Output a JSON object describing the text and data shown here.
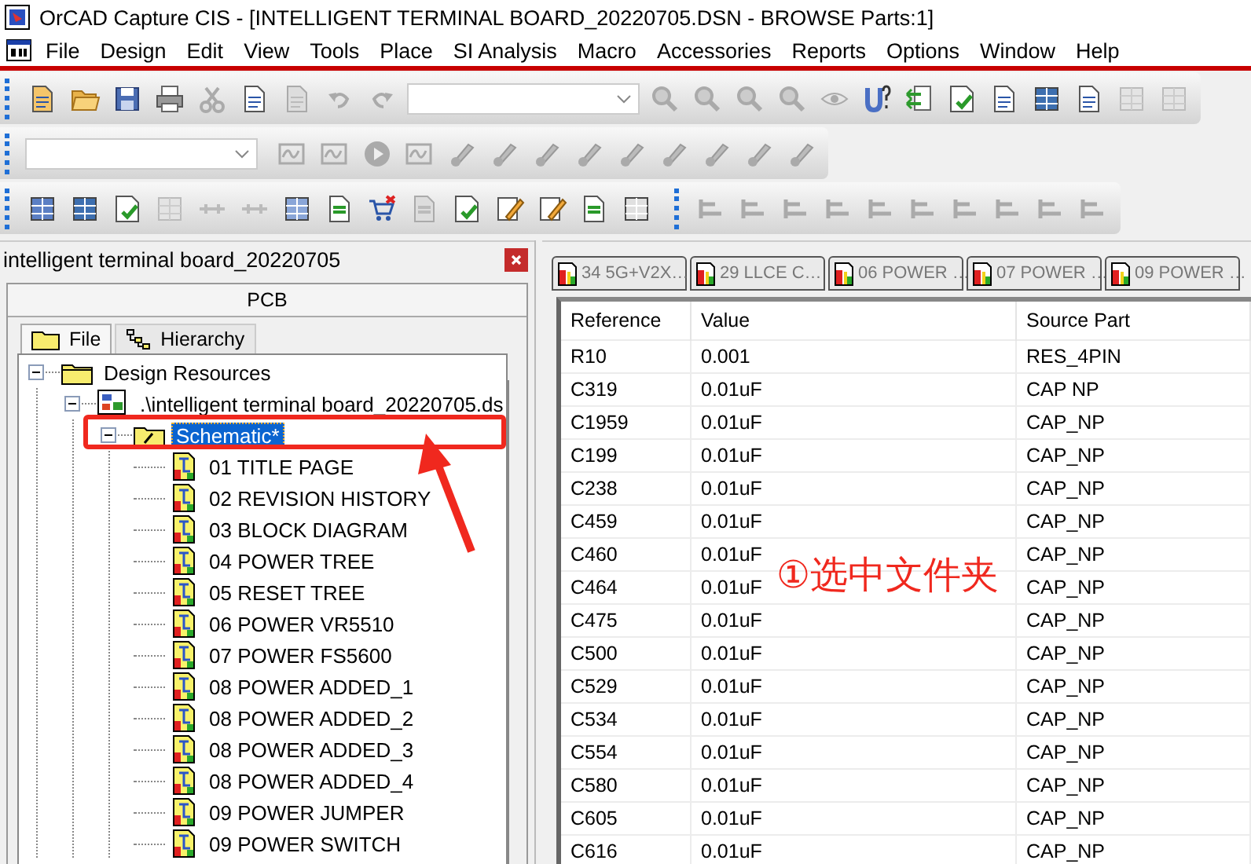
{
  "window": {
    "title": "OrCAD Capture CIS - [INTELLIGENT TERMINAL BOARD_20220705.DSN - BROWSE Parts:1]"
  },
  "menu": [
    "File",
    "Design",
    "Edit",
    "View",
    "Tools",
    "Place",
    "SI Analysis",
    "Macro",
    "Accessories",
    "Reports",
    "Options",
    "Window",
    "Help"
  ],
  "project_panel": {
    "title": "intelligent terminal board_20220705",
    "header": "PCB",
    "tabs": [
      {
        "label": "File",
        "selected": true
      },
      {
        "label": "Hierarchy",
        "selected": false
      }
    ],
    "tree": [
      {
        "label": "Design Resources",
        "kind": "folder",
        "expanded": true,
        "selected": false,
        "children": [
          {
            "label": ".\\intelligent terminal board_20220705.ds",
            "kind": "design",
            "expanded": true,
            "selected": false,
            "children": [
              {
                "label": "Schematic*",
                "kind": "schematic",
                "expanded": true,
                "selected": true,
                "children": [
                  {
                    "label": "01 TITLE PAGE",
                    "kind": "page",
                    "selected": false
                  },
                  {
                    "label": "02 REVISION HISTORY",
                    "kind": "page",
                    "selected": false
                  },
                  {
                    "label": "03 BLOCK DIAGRAM",
                    "kind": "page",
                    "selected": false
                  },
                  {
                    "label": "04 POWER TREE",
                    "kind": "page",
                    "selected": false
                  },
                  {
                    "label": "05 RESET TREE",
                    "kind": "page",
                    "selected": false
                  },
                  {
                    "label": "06 POWER VR5510",
                    "kind": "page",
                    "selected": false
                  },
                  {
                    "label": "07 POWER FS5600",
                    "kind": "page",
                    "selected": false
                  },
                  {
                    "label": "08 POWER ADDED_1",
                    "kind": "page",
                    "selected": false
                  },
                  {
                    "label": "08 POWER ADDED_2",
                    "kind": "page",
                    "selected": false
                  },
                  {
                    "label": "08 POWER ADDED_3",
                    "kind": "page",
                    "selected": false
                  },
                  {
                    "label": "08 POWER ADDED_4",
                    "kind": "page",
                    "selected": false
                  },
                  {
                    "label": "09 POWER JUMPER",
                    "kind": "page",
                    "selected": false
                  },
                  {
                    "label": "09 POWER SWITCH",
                    "kind": "page",
                    "selected": false
                  }
                ]
              }
            ]
          }
        ]
      }
    ]
  },
  "document_tabs": [
    {
      "label": "34 5G+V2X…",
      "selected": false
    },
    {
      "label": "29 LLCE C…",
      "selected": false
    },
    {
      "label": "06 POWER …",
      "selected": false
    },
    {
      "label": "07 POWER …",
      "selected": false
    },
    {
      "label": "09 POWER …",
      "selected": false
    }
  ],
  "table": {
    "columns": [
      "Reference",
      "Value",
      "Source Part"
    ],
    "rows": [
      [
        "R10",
        "0.001",
        "RES_4PIN"
      ],
      [
        "C319",
        "0.01uF",
        "CAP NP"
      ],
      [
        "C1959",
        "0.01uF",
        "CAP_NP"
      ],
      [
        "C199",
        "0.01uF",
        "CAP_NP"
      ],
      [
        "C238",
        "0.01uF",
        "CAP_NP"
      ],
      [
        "C459",
        "0.01uF",
        "CAP_NP"
      ],
      [
        "C460",
        "0.01uF",
        "CAP_NP"
      ],
      [
        "C464",
        "0.01uF",
        "CAP_NP"
      ],
      [
        "C475",
        "0.01uF",
        "CAP_NP"
      ],
      [
        "C500",
        "0.01uF",
        "CAP_NP"
      ],
      [
        "C529",
        "0.01uF",
        "CAP_NP"
      ],
      [
        "C534",
        "0.01uF",
        "CAP_NP"
      ],
      [
        "C554",
        "0.01uF",
        "CAP_NP"
      ],
      [
        "C580",
        "0.01uF",
        "CAP_NP"
      ],
      [
        "C605",
        "0.01uF",
        "CAP_NP"
      ],
      [
        "C616",
        "0.01uF",
        "CAP_NP"
      ]
    ]
  },
  "annotation": {
    "text": "①选中文件夹"
  }
}
